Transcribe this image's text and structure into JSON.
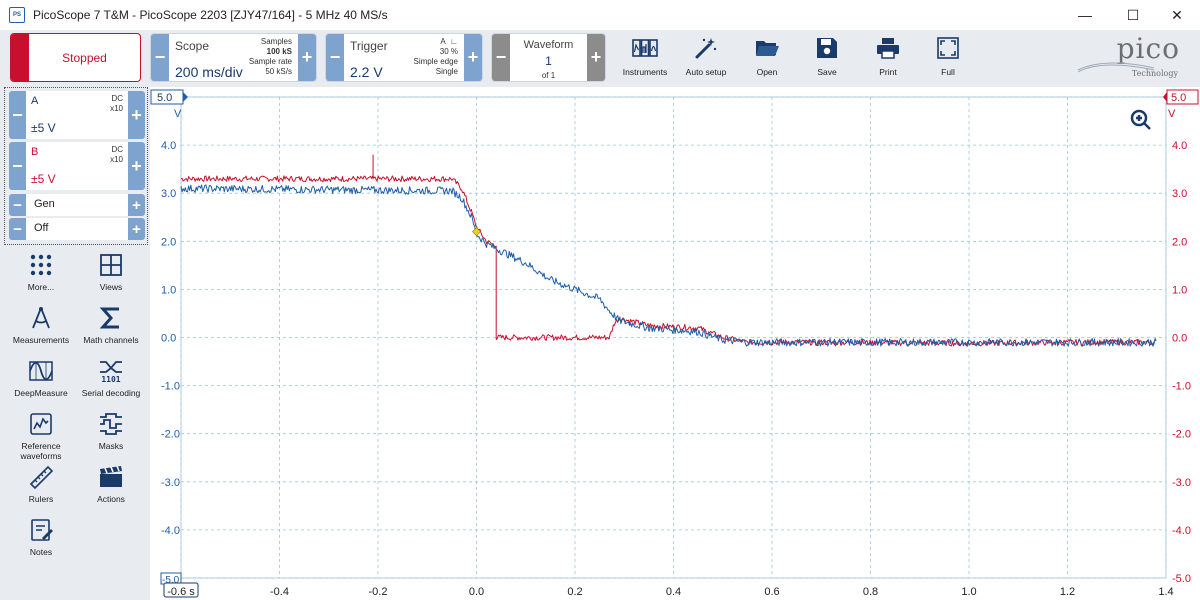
{
  "window": {
    "title": "PicoScope 7 T&M  -  PicoScope 2203 [ZJY47/164] - 5 MHz 40 MS/s",
    "logo_text": "PS",
    "controls": [
      "minimize-icon",
      "maximize-icon",
      "close-icon"
    ]
  },
  "toolbar": {
    "run_state": "Stopped",
    "scope": {
      "label": "Scope",
      "value": "200 ms/div",
      "samples_label": "Samples",
      "samples": "100 kS",
      "rate_label": "Sample rate",
      "rate": "50 kS/s"
    },
    "trigger": {
      "label": "Trigger",
      "value": "2.2 V",
      "channel": "A",
      "edge_icon": "rising-edge-icon",
      "pretrigger": "30 %",
      "type": "Simple edge",
      "mode": "Single"
    },
    "waveform": {
      "label": "Waveform",
      "value": "1",
      "of": "of 1"
    },
    "tools": [
      {
        "label": "Instruments",
        "icon": "instruments-icon"
      },
      {
        "label": "Auto setup",
        "icon": "auto-setup-icon"
      },
      {
        "label": "Open",
        "icon": "folder-icon"
      },
      {
        "label": "Save",
        "icon": "save-icon"
      },
      {
        "label": "Print",
        "icon": "print-icon"
      },
      {
        "label": "Full",
        "icon": "fullscreen-icon"
      }
    ],
    "brand": {
      "name": "pico",
      "sub": "Technology"
    }
  },
  "channels": [
    {
      "name": "A",
      "coupling": "DC",
      "probe": "x10",
      "range": "±5 V",
      "color": "#1f5ea8"
    },
    {
      "name": "B",
      "coupling": "DC",
      "probe": "x10",
      "range": "±5 V",
      "color": "#c8102e"
    }
  ],
  "generator": {
    "label": "Gen",
    "state": "Off"
  },
  "sidebar_tools": [
    {
      "label": "More...",
      "icon": "more-dots-icon"
    },
    {
      "label": "Views",
      "icon": "views-grid-icon"
    },
    {
      "label": "Measurements",
      "icon": "measurements-icon"
    },
    {
      "label": "Math channels",
      "icon": "sigma-icon"
    },
    {
      "label": "DeepMeasure",
      "icon": "deepmeasure-icon"
    },
    {
      "label": "Serial decoding",
      "icon": "serial-decoding-icon"
    },
    {
      "label": "Reference waveforms",
      "icon": "reference-waveforms-icon"
    },
    {
      "label": "Masks",
      "icon": "masks-icon"
    },
    {
      "label": "Rulers",
      "icon": "ruler-icon"
    },
    {
      "label": "Actions",
      "icon": "clapper-icon"
    },
    {
      "label": "Notes",
      "icon": "notes-icon"
    }
  ],
  "scope_view": {
    "left_axis": {
      "ticks": [
        "5.0",
        "4.0",
        "3.0",
        "2.0",
        "1.0",
        "0.0",
        "-1.0",
        "-2.0",
        "-3.0",
        "-4.0",
        "-5.0"
      ],
      "unit": "V",
      "color": "#1f5ea8",
      "top_marker": "5.0"
    },
    "right_axis": {
      "ticks": [
        "5.0",
        "4.0",
        "3.0",
        "2.0",
        "1.0",
        "0.0",
        "-1.0",
        "-2.0",
        "-3.0",
        "-4.0",
        "-5.0"
      ],
      "unit": "V",
      "color": "#c8102e",
      "top_marker": "5.0"
    },
    "x_axis": {
      "ticks": [
        "-0.6 s",
        "-0.4",
        "-0.2",
        "0.0",
        "0.2",
        "0.4",
        "0.6",
        "0.8",
        "1.0",
        "1.2",
        "1.4"
      ]
    },
    "zoom_icon": "zoom-icon",
    "trigger_marker_color": "#f0d020"
  },
  "chart_data": {
    "type": "line",
    "xlabel": "",
    "ylabel": "V",
    "xlim": [
      -0.6,
      1.4
    ],
    "ylim": [
      -5,
      5
    ],
    "grid": true,
    "series": [
      {
        "name": "A",
        "color": "#1f5ea8",
        "x": [
          -0.6,
          -0.05,
          -0.03,
          -0.01,
          0.0,
          0.02,
          0.05,
          0.1,
          0.15,
          0.2,
          0.25,
          0.27,
          0.29,
          0.35,
          0.45,
          0.5,
          0.55,
          0.7,
          1.0,
          1.2,
          1.38
        ],
        "y": [
          3.1,
          3.05,
          2.9,
          2.5,
          2.15,
          1.95,
          1.8,
          1.55,
          1.2,
          1.0,
          0.8,
          0.55,
          0.35,
          0.2,
          0.12,
          -0.05,
          -0.1,
          -0.1,
          -0.1,
          -0.1,
          -0.1
        ]
      },
      {
        "name": "B",
        "color": "#c8102e",
        "x": [
          -0.6,
          -0.05,
          -0.03,
          -0.01,
          0.0,
          0.02,
          0.04,
          0.04,
          0.27,
          0.28,
          0.29,
          0.35,
          0.45,
          0.5,
          0.55,
          0.7,
          1.0,
          1.2,
          1.38
        ],
        "y": [
          3.3,
          3.3,
          3.1,
          2.6,
          2.3,
          2.0,
          1.9,
          0.0,
          0.0,
          0.3,
          0.4,
          0.25,
          0.2,
          0.0,
          -0.1,
          -0.1,
          -0.12,
          -0.1,
          -0.1
        ]
      }
    ],
    "annotations": [
      {
        "type": "spike",
        "series": "B",
        "x": -0.21,
        "y": 3.8
      },
      {
        "type": "trigger",
        "x": 0.0,
        "y": 2.2
      }
    ]
  }
}
